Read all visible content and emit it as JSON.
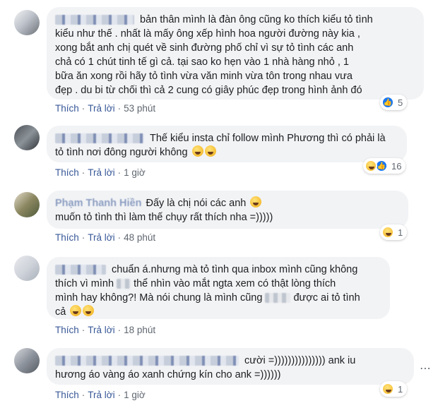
{
  "comments": [
    {
      "body_lines": [
        "bản thân mình là đàn ông cũng ko thích kiểu tỏ tình",
        "kiểu như thế . nhất là mấy ông xếp hình hoa người đường này kia ,",
        "xong bắt anh chị quét về sinh đường phố chỉ vì sự tỏ tình các anh",
        "chả có 1 chút tinh tế gì cả. tại sao ko hẹn vào 1 nhà hàng nhỏ , 1",
        "bữa ăn xong rồi hãy tỏ tình vừa văn minh vừa tôn trong nhau vưa",
        "đẹp . du bi từ chối thì cả 2 cung có giây phúc đẹp trong hình ảnh đó"
      ],
      "actions": {
        "like": "Thích",
        "reply": "Trả lời",
        "time": "53 phút"
      },
      "reaction": {
        "icon": "like-icon",
        "count": "5"
      }
    },
    {
      "body_lines": [
        "Thế kiểu insta chỉ follow mình Phương thì có phải là",
        "tỏ tình nơi đông người không"
      ],
      "actions": {
        "like": "Thích",
        "reply": "Trả lời",
        "time": "1 giờ"
      },
      "reaction": {
        "icon": "haha-and-like-icons",
        "count": "16"
      }
    },
    {
      "name": "Phạm Thanh Hiền",
      "body_lines": [
        "Đấy là chị nói các anh",
        "muốn tỏ tình thì làm thế chụy rất thích nha =)))))"
      ],
      "actions": {
        "like": "Thích",
        "reply": "Trả lời",
        "time": "48 phút"
      },
      "reaction": {
        "icon": "haha-icon",
        "count": "1"
      }
    },
    {
      "body_lines": [
        "chuẩn á.nhưng mà tỏ tình qua inbox mình cũng không",
        "thích vì mình",
        "thể nhìn vào mắt ngta xem có thật lòng thích",
        "mình hay không?! Mà nói chung là mình cũng",
        "được ai tỏ tình",
        "cả"
      ],
      "actions": {
        "like": "Thích",
        "reply": "Trả lời",
        "time": "18 phút"
      },
      "reaction": null
    },
    {
      "body_lines": [
        "cười =))))))))))))))) ank iu",
        "hương áo vàng áo xanh chứng kín cho ank =))))))"
      ],
      "actions": {
        "like": "Thích",
        "reply": "Trả lời",
        "time": "1 giờ"
      },
      "reaction": {
        "icon": "haha-icon",
        "count": "1"
      },
      "more_icon": "more-dots-icon"
    }
  ],
  "colors": {
    "bubble": "#f2f3f5",
    "link": "#385898",
    "meta": "#606770",
    "like": "#1877f2"
  }
}
